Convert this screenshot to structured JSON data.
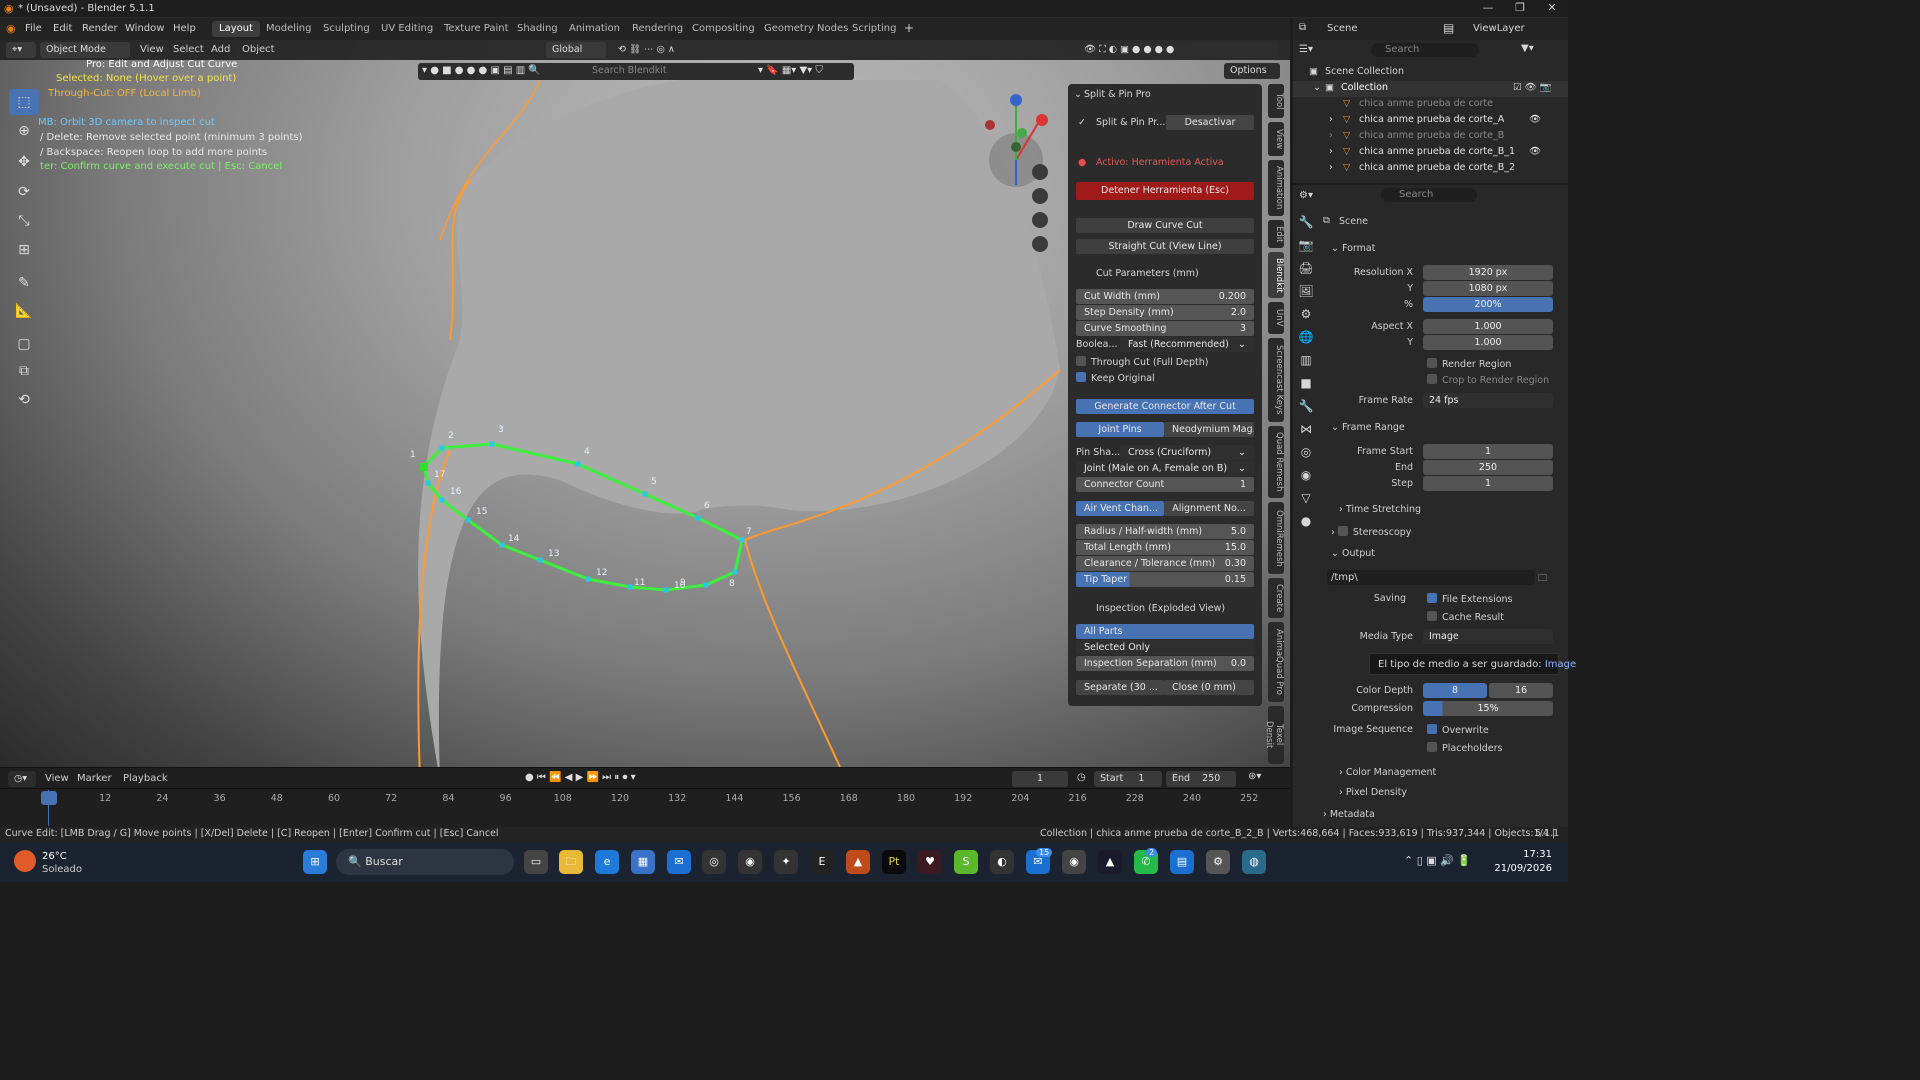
{
  "window": {
    "title": "* (Unsaved) - Blender 5.1.1"
  },
  "menu": [
    "File",
    "Edit",
    "Render",
    "Window",
    "Help"
  ],
  "workspaces": [
    "Layout",
    "Modeling",
    "Sculpting",
    "UV Editing",
    "Texture Paint",
    "Shading",
    "Animation",
    "Rendering",
    "Compositing",
    "Geometry Nodes",
    "Scripting"
  ],
  "header": {
    "mode": "Object Mode",
    "view": "View",
    "select": "Select",
    "add": "Add",
    "object": "Object",
    "orientation": "Global",
    "search_placeholder": "Search Blendkit",
    "options": "Options"
  },
  "hints": {
    "h1": "Pro: Edit and Adjust Cut Curve",
    "h2": "Selected: None (Hover over a point)",
    "h3": "Through-Cut: OFF (Local Limb)",
    "h4": "MB: Orbit 3D camera to inspect cut",
    "h5": "/ Delete: Remove selected point (minimum 3 points)",
    "h6": "/ Backspace: Reopen loop to add more points",
    "h7": "ter: Confirm curve and execute cut  |  Esc: Cancel"
  },
  "curve": {
    "point_labels": [
      "1",
      "2",
      "3",
      "4",
      "5",
      "6",
      "7",
      "8",
      "9",
      "10",
      "11",
      "12",
      "13",
      "14",
      "15",
      "16",
      "17"
    ]
  },
  "npanel": {
    "title": "Split & Pin Pro",
    "addon_btn": "Split & Pin Pr...",
    "deactivate": "Desactivar",
    "status": "Activo: Herramienta Activa",
    "stop": "Detener Herramienta (Esc)",
    "draw_curve": "Draw Curve Cut",
    "straight": "Straight Cut (View Line)",
    "cut_params": "Cut Parameters (mm)",
    "cut_width_l": "Cut Width (mm)",
    "cut_width_v": "0.200",
    "step_l": "Step Density (mm)",
    "step_v": "2.0",
    "smooth_l": "Curve Smoothing",
    "smooth_v": "3",
    "bool_l": "Boolea...",
    "bool_v": "Fast (Recommended)",
    "through": "Through Cut (Full Depth)",
    "keep": "Keep Original",
    "gen_conn": "Generate Connector After Cut",
    "joint_pins": "Joint Pins",
    "neo": "Neodymium Mag...",
    "pin_l": "Pin Sha...",
    "pin_v": "Cross (Cruciform)",
    "joint_v": "Joint (Male on A, Female on B)",
    "conn_l": "Connector Count",
    "conn_v": "1",
    "air": "Air Vent Chan...",
    "align": "Alignment No...",
    "radius_l": "Radius / Half-width (mm)",
    "radius_v": "5.0",
    "length_l": "Total Length (mm)",
    "length_v": "15.0",
    "clear_l": "Clearance / Tolerance (mm)",
    "clear_v": "0.30",
    "taper_l": "Tip Taper",
    "taper_v": "0.15",
    "inspect": "Inspection (Exploded View)",
    "all_parts": "All Parts",
    "selected_only": "Selected Only",
    "insp_sep_l": "Inspection Separation (mm)",
    "insp_sep_v": "0.0",
    "separate": "Separate (30 ...",
    "close": "Close (0 mm)"
  },
  "sidetabs": [
    "Tool",
    "View",
    "Animation",
    "Edit",
    "Blendkit",
    "UnV",
    "Screencast Keys",
    "Quad Remesh",
    "OmniRemesh",
    "Create",
    "AnimaQuad Pro",
    "Texel Densit"
  ],
  "timeline": {
    "view": "View",
    "marker": "Marker",
    "playback": "Playback",
    "current": "1",
    "start_l": "Start",
    "start": "1",
    "end_l": "End",
    "end": "250",
    "ticks": [
      "1",
      "12",
      "24",
      "36",
      "48",
      "60",
      "72",
      "84",
      "96",
      "108",
      "120",
      "132",
      "144",
      "156",
      "168",
      "180",
      "192",
      "204",
      "216",
      "228",
      "240",
      "252"
    ]
  },
  "status": {
    "left": "Curve Edit: [LMB Drag / G] Move points | [X/Del] Delete | [C] Reopen | [Enter] Confirm cut | [Esc] Cancel",
    "right": "Collection | chica anme prueba de corte_B_2_B | Verts:468,664 | Faces:933,619 | Tris:937,344 | Objects:1/4 | ",
    "version": "5.1.1"
  },
  "outliner": {
    "scene": "Scene",
    "viewlayer": "ViewLayer",
    "search": "Search",
    "root": "Scene Collection",
    "collection": "Collection",
    "items": [
      "chica anme prueba de corte",
      "chica anme prueba de corte_A",
      "chica anme prueba de corte_B",
      "chica anme prueba de corte_B_1",
      "chica anme prueba de corte_B_2"
    ]
  },
  "props": {
    "search": "Search",
    "scene": "Scene",
    "format": "Format",
    "resx_l": "Resolution X",
    "resx": "1920 px",
    "resy_l": "Y",
    "resy": "1080 px",
    "pct_l": "%",
    "pct": "200%",
    "aspx_l": "Aspect X",
    "aspx": "1.000",
    "aspy_l": "Y",
    "aspy": "1.000",
    "render_region": "Render Region",
    "crop": "Crop to Render Region",
    "fr_l": "Frame Rate",
    "fr": "24 fps",
    "frame_range": "Frame Range",
    "fs_l": "Frame Start",
    "fs": "1",
    "fe_l": "End",
    "fe": "250",
    "st_l": "Step",
    "st": "1",
    "time_stretch": "Time Stretching",
    "stereo": "Stereoscopy",
    "output": "Output",
    "path": "/tmp\\",
    "saving": "Saving",
    "file_ext": "File Extensions",
    "cache": "Cache Result",
    "media_l": "Media Type",
    "media": "Image",
    "tooltip": "El tipo de medio a ser guardado:",
    "tooltip_val": "Image",
    "depth_l": "Color Depth",
    "depth8": "8",
    "depth16": "16",
    "comp_l": "Compression",
    "comp": "15%",
    "seq_l": "Image Sequence",
    "overwrite": "Overwrite",
    "placeholders": "Placeholders",
    "color_mgmt": "Color Management",
    "pixel_density": "Pixel Density",
    "metadata": "Metadata"
  },
  "taskbar": {
    "temp": "26°C",
    "weather": "Soleado",
    "search": "Buscar",
    "time": "17:31",
    "date": "21/09/2026",
    "badge1": "15",
    "badge2": "2"
  }
}
